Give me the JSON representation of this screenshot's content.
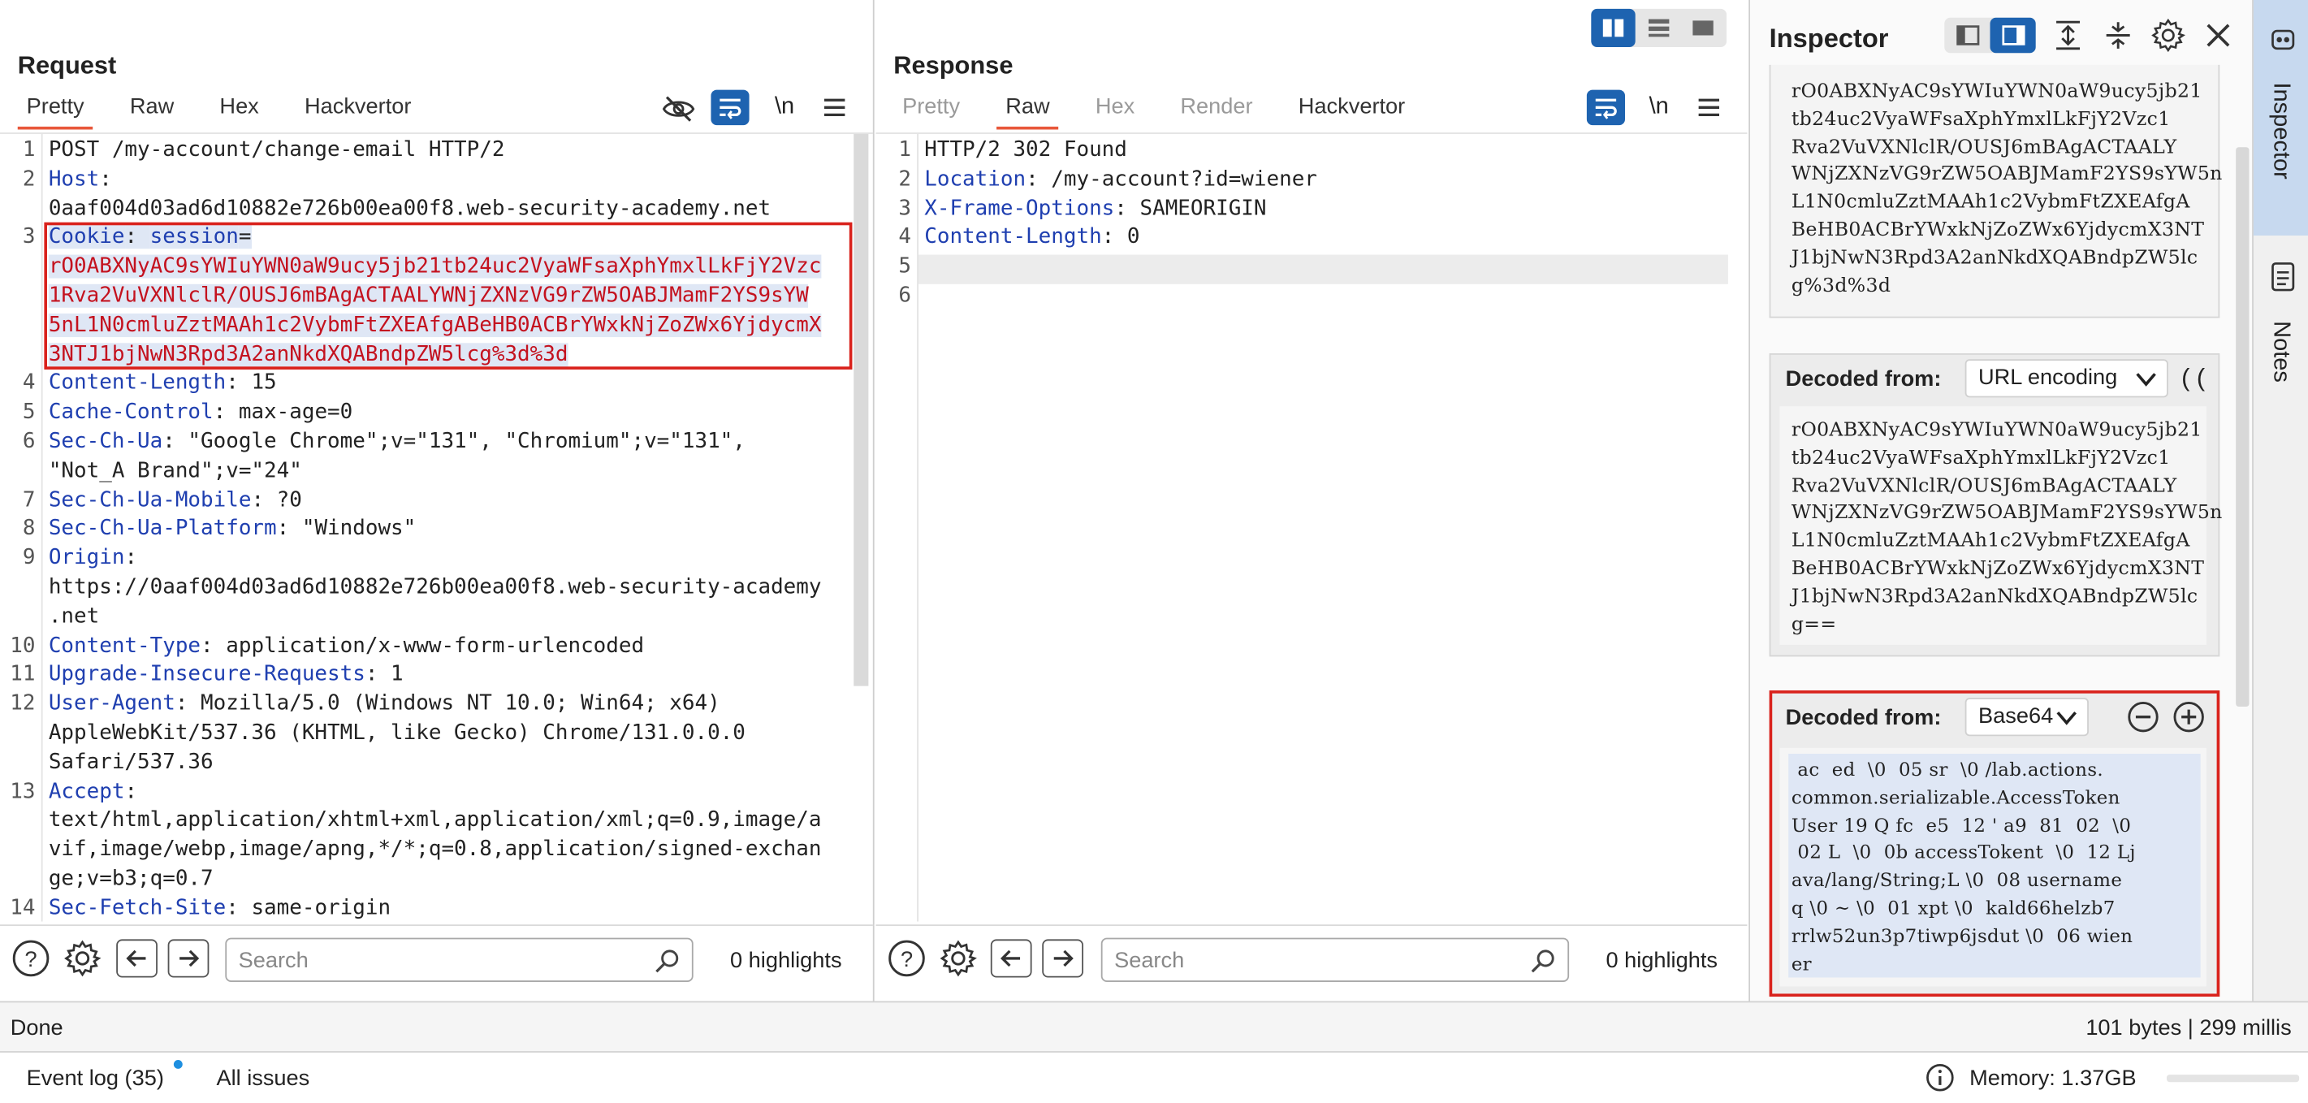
{
  "request": {
    "title": "Request",
    "tabs": [
      "Pretty",
      "Raw",
      "Hex",
      "Hackvertor"
    ],
    "newline_icon": "\\n",
    "lines": [
      {
        "n": "1",
        "parts": [
          {
            "t": "POST /my-account/change-email HTTP/2",
            "c": "hv"
          }
        ]
      },
      {
        "n": "2",
        "parts": [
          {
            "t": "Host",
            "c": "hk"
          },
          {
            "t": ":",
            "c": "hv"
          }
        ]
      },
      {
        "n": "",
        "parts": [
          {
            "t": "0aaf004d03ad6d10882e726b00ea00f8.web-security-academy.net",
            "c": "hv"
          }
        ]
      },
      {
        "n": "3",
        "parts": [
          {
            "t": "Cookie",
            "c": "hk"
          },
          {
            "t": ": ",
            "c": "hv"
          },
          {
            "t": "session",
            "c": "hk"
          },
          {
            "t": "=",
            "c": "hv"
          }
        ]
      },
      {
        "n": "",
        "parts": [
          {
            "t": "rO0ABXNyAC9sYWIuYWN0aW9ucy5jb21tb24uc2VyaWFsaXphYmxlLkFjY2Vzc",
            "c": "cookie"
          }
        ]
      },
      {
        "n": "",
        "parts": [
          {
            "t": "1Rva2VuVXNlclR/OUSJ6mBAgACTAALYWNjZXNzVG9rZW5OABJMamF2YS9sYW",
            "c": "cookie"
          }
        ]
      },
      {
        "n": "",
        "parts": [
          {
            "t": "5nL1N0cmluZztMAAh1c2VybmFtZXEAfgABeHB0ACBrYWxkNjZoZWx6YjdycmX",
            "c": "cookie"
          }
        ]
      },
      {
        "n": "",
        "parts": [
          {
            "t": "3NTJ1bjNwN3Rpd3A2anNkdXQABndpZW5lcg%3d%3d",
            "c": "cookie"
          }
        ]
      },
      {
        "n": "4",
        "parts": [
          {
            "t": "Content-Length",
            "c": "hk"
          },
          {
            "t": ": 15",
            "c": "hv"
          }
        ]
      },
      {
        "n": "5",
        "parts": [
          {
            "t": "Cache-Control",
            "c": "hk"
          },
          {
            "t": ": max-age=0",
            "c": "hv"
          }
        ]
      },
      {
        "n": "6",
        "parts": [
          {
            "t": "Sec-Ch-Ua",
            "c": "hk"
          },
          {
            "t": ": \"Google Chrome\";v=\"131\", \"Chromium\";v=\"131\",",
            "c": "hv"
          }
        ]
      },
      {
        "n": "",
        "parts": [
          {
            "t": "\"Not_A Brand\";v=\"24\"",
            "c": "hv"
          }
        ]
      },
      {
        "n": "7",
        "parts": [
          {
            "t": "Sec-Ch-Ua-Mobile",
            "c": "hk"
          },
          {
            "t": ": ?0",
            "c": "hv"
          }
        ]
      },
      {
        "n": "8",
        "parts": [
          {
            "t": "Sec-Ch-Ua-Platform",
            "c": "hk"
          },
          {
            "t": ": \"Windows\"",
            "c": "hv"
          }
        ]
      },
      {
        "n": "9",
        "parts": [
          {
            "t": "Origin",
            "c": "hk"
          },
          {
            "t": ":",
            "c": "hv"
          }
        ]
      },
      {
        "n": "",
        "parts": [
          {
            "t": "https://0aaf004d03ad6d10882e726b00ea00f8.web-security-academy",
            "c": "hv"
          }
        ]
      },
      {
        "n": "",
        "parts": [
          {
            "t": ".net",
            "c": "hv"
          }
        ]
      },
      {
        "n": "10",
        "parts": [
          {
            "t": "Content-Type",
            "c": "hk"
          },
          {
            "t": ": application/x-www-form-urlencoded",
            "c": "hv"
          }
        ]
      },
      {
        "n": "11",
        "parts": [
          {
            "t": "Upgrade-Insecure-Requests",
            "c": "hk"
          },
          {
            "t": ": 1",
            "c": "hv"
          }
        ]
      },
      {
        "n": "12",
        "parts": [
          {
            "t": "User-Agent",
            "c": "hk"
          },
          {
            "t": ": Mozilla/5.0 (Windows NT 10.0; Win64; x64)",
            "c": "hv"
          }
        ]
      },
      {
        "n": "",
        "parts": [
          {
            "t": "AppleWebKit/537.36 (KHTML, like Gecko) Chrome/131.0.0.0",
            "c": "hv"
          }
        ]
      },
      {
        "n": "",
        "parts": [
          {
            "t": "Safari/537.36",
            "c": "hv"
          }
        ]
      },
      {
        "n": "13",
        "parts": [
          {
            "t": "Accept",
            "c": "hk"
          },
          {
            "t": ":",
            "c": "hv"
          }
        ]
      },
      {
        "n": "",
        "parts": [
          {
            "t": "text/html,application/xhtml+xml,application/xml;q=0.9,image/a",
            "c": "hv"
          }
        ]
      },
      {
        "n": "",
        "parts": [
          {
            "t": "vif,image/webp,image/apng,*/*;q=0.8,application/signed-exchan",
            "c": "hv"
          }
        ]
      },
      {
        "n": "",
        "parts": [
          {
            "t": "ge;v=b3;q=0.7",
            "c": "hv"
          }
        ]
      },
      {
        "n": "14",
        "parts": [
          {
            "t": "Sec-Fetch-Site",
            "c": "hk"
          },
          {
            "t": ": same-origin",
            "c": "hv"
          }
        ]
      }
    ],
    "search_placeholder": "Search",
    "highlights": "0 highlights"
  },
  "response": {
    "title": "Response",
    "tabs": [
      "Pretty",
      "Raw",
      "Hex",
      "Render",
      "Hackvertor"
    ],
    "newline_icon": "\\n",
    "lines": [
      {
        "n": "1",
        "parts": [
          {
            "t": "HTTP/2 302 Found",
            "c": "hv"
          }
        ]
      },
      {
        "n": "2",
        "parts": [
          {
            "t": "Location",
            "c": "hk"
          },
          {
            "t": ": /my-account?id=wiener",
            "c": "hv"
          }
        ]
      },
      {
        "n": "3",
        "parts": [
          {
            "t": "X-Frame-Options",
            "c": "hk"
          },
          {
            "t": ": SAMEORIGIN",
            "c": "hv"
          }
        ]
      },
      {
        "n": "4",
        "parts": [
          {
            "t": "Content-Length",
            "c": "hk"
          },
          {
            "t": ": 0",
            "c": "hv"
          }
        ]
      },
      {
        "n": "5",
        "parts": []
      },
      {
        "n": "6",
        "parts": []
      }
    ],
    "search_placeholder": "Search",
    "highlights": "0 highlights"
  },
  "inspector": {
    "title": "Inspector",
    "selected_text": "rO0ABXNyAC9sYWIuYWN0aW9ucy5jb21\ntb24uc2VyaWFsaXphYmxlLkFjY2Vzc1\nRva2VuVXNlclR/OUSJ6mBAgACTAALY\nWNjZXNzVG9rZW5OABJMamF2YS9sYW5n\nL1N0cmluZztMAAh1c2VybmFtZXEAfgA\nBeHB0ACBrYWxkNjZoZWx6YjdycmX3NT\nJ1bjNwN3Rpd3A2anNkdXQABndpZW5lc\ng%3d%3d",
    "decoded_label": "Decoded from:",
    "decoded1": {
      "type": "URL encoding",
      "text": "rO0ABXNyAC9sYWIuYWN0aW9ucy5jb21\ntb24uc2VyaWFsaXphYmxlLkFjY2Vzc1\nRva2VuVXNlclR/OUSJ6mBAgACTAALY\nWNjZXNzVG9rZW5OABJMamF2YS9sYW5n\nL1N0cmluZztMAAh1c2VybmFtZXEAfgA\nBeHB0ACBrYWxkNjZoZWx6YjdycmX3NT\nJ1bjNwN3Rpd3A2anNkdXQABndpZW5lc\ng=="
    },
    "decoded2": {
      "type": "Base64",
      "text": " ac  ed  \\0  05 sr  \\0 /lab.actions.\ncommon.serializable.AccessToken\nUser 19 Q fc  e5  12 ' a9  81  02  \\0\n 02 L  \\0  0b accessTokent  \\0  12 Lj\nava/lang/String;L \\0  08 username\nq \\0 ~ \\0  01 xpt \\0  kald66helzb7\nrrlw52un3p7tiwp6jsdut \\0  06 wien\ner"
    }
  },
  "side_tabs": [
    "Inspector",
    "Notes"
  ],
  "status": {
    "left": "Done",
    "right": "101 bytes | 299 millis"
  },
  "footer": {
    "event_log": "Event log (35)",
    "all_issues": "All issues",
    "memory": "Memory: 1.37GB"
  },
  "colors": {
    "accent": "#e8573a",
    "blue_button": "#1e63b0",
    "highlight_border": "#d9221c",
    "selection": "#dfe7f5",
    "side_tab_active": "#c7d9ef"
  }
}
